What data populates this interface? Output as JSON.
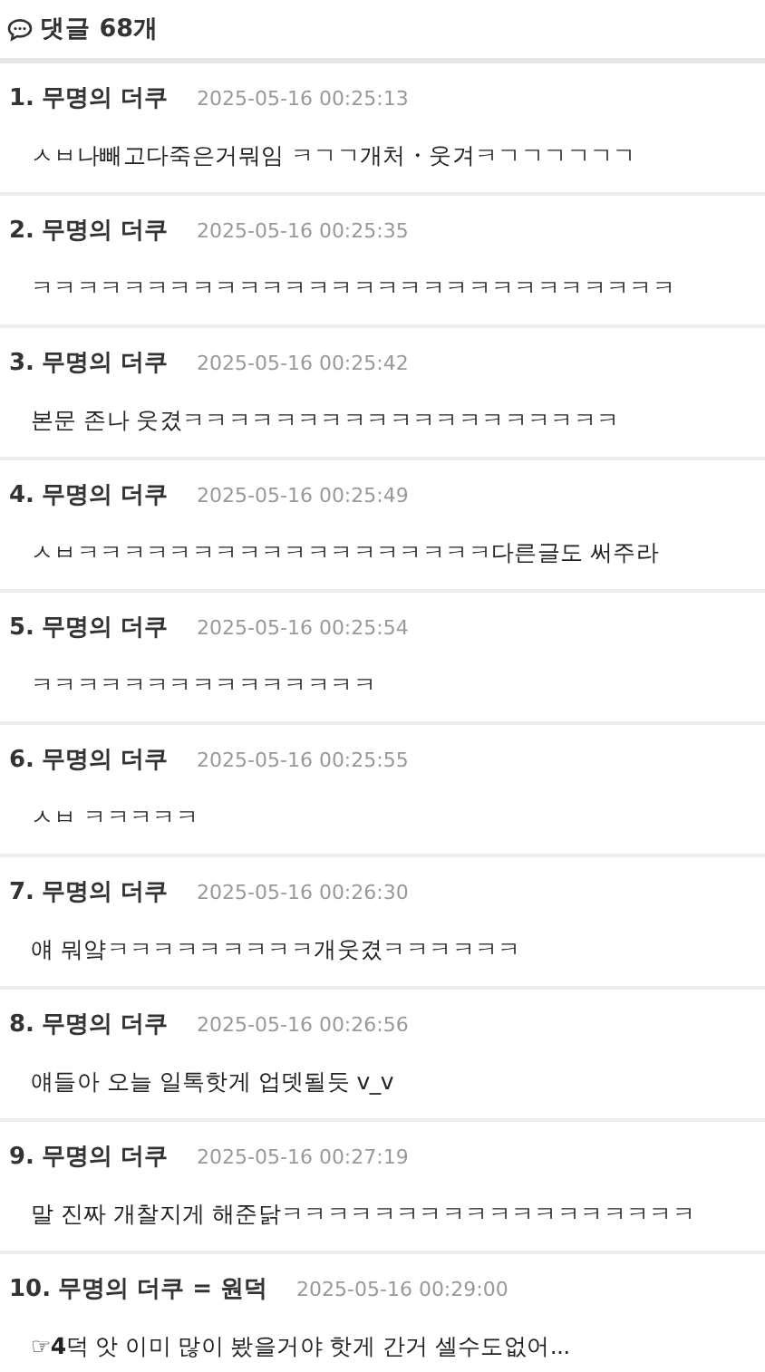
{
  "header": {
    "title": "댓글 68개"
  },
  "comments": [
    {
      "number": "1.",
      "author": "무명의 더쿠",
      "time": "2025-05-16 00:25:13",
      "text": "ㅅㅂ나빼고다죽은거뭐임 ㅋㄱㄱ개처・웃겨ㅋㄱㄱㄱㄱㄱㄱ"
    },
    {
      "number": "2.",
      "author": "무명의 더쿠",
      "time": "2025-05-16 00:25:35",
      "text": "ㅋㅋㅋㅋㅋㅋㅋㅋㅋㅋㅋㅋㅋㅋㅋㅋㅋㅋㅋㅋㅋㅋㅋㅋㅋㅋㅋㅋ"
    },
    {
      "number": "3.",
      "author": "무명의 더쿠",
      "time": "2025-05-16 00:25:42",
      "text": "본문 존나 웃겼ㅋㅋㅋㅋㅋㅋㅋㅋㅋㅋㅋㅋㅋㅋㅋㅋㅋㅋㅋ"
    },
    {
      "number": "4.",
      "author": "무명의 더쿠",
      "time": "2025-05-16 00:25:49",
      "text": "ㅅㅂㅋㅋㅋㅋㅋㅋㅋㅋㅋㅋㅋㅋㅋㅋㅋㅋㅋㅋ다른글도 써주라"
    },
    {
      "number": "5.",
      "author": "무명의 더쿠",
      "time": "2025-05-16 00:25:54",
      "text": "ㅋㅋㅋㅋㅋㅋㅋㅋㅋㅋㅋㅋㅋㅋㅋ"
    },
    {
      "number": "6.",
      "author": "무명의 더쿠",
      "time": "2025-05-16 00:25:55",
      "text": "ㅅㅂ ㅋㅋㅋㅋㅋ"
    },
    {
      "number": "7.",
      "author": "무명의 더쿠",
      "time": "2025-05-16 00:26:30",
      "text": "얘 뭐얔ㅋㅋㅋㅋㅋㅋㅋㅋㅋ개웃겼ㅋㅋㅋㅋㅋㅋ"
    },
    {
      "number": "8.",
      "author": "무명의 더쿠",
      "time": "2025-05-16 00:26:56",
      "text": "얘들아 오늘 일톡핫게 업뎃될듯 v_v"
    },
    {
      "number": "9.",
      "author": "무명의 더쿠",
      "time": "2025-05-16 00:27:19",
      "text": "말 진짜 개찰지게 해준닭ㅋㅋㅋㅋㅋㅋㅋㅋㅋㅋㅋㅋㅋㅋㅋㅋㅋㅋ"
    },
    {
      "number": "10.",
      "author": "무명의 더쿠 = 원덕",
      "time": "2025-05-16 00:29:00",
      "text": "☞**4**덕 앗 이미 많이 봤을거야 핫게 간거 셀수도없어..."
    }
  ]
}
